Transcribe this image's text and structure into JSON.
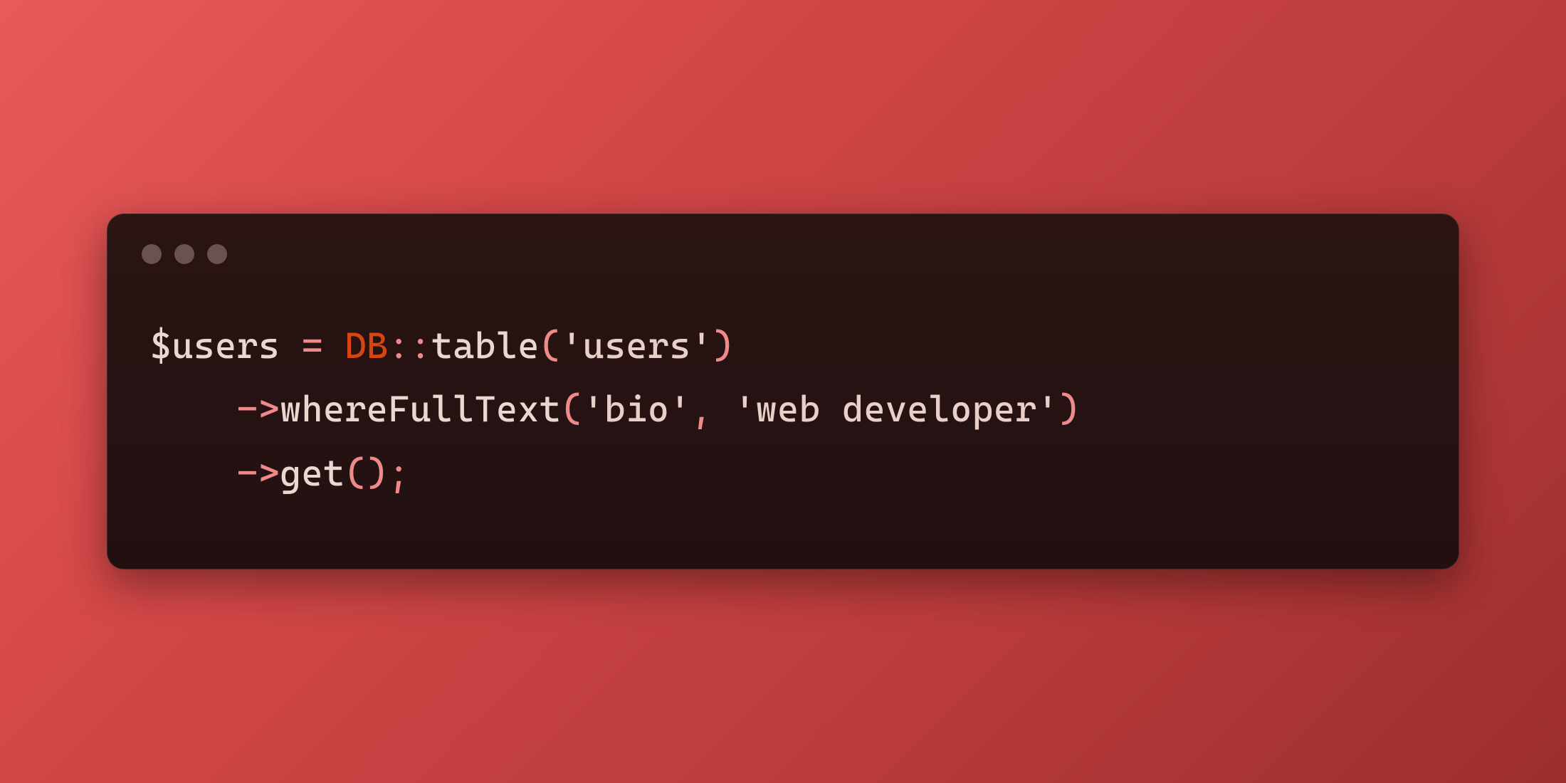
{
  "code": {
    "lines": [
      {
        "indent": "",
        "tokens": [
          {
            "cls": "tok-default",
            "text": "$users "
          },
          {
            "cls": "tok-punct",
            "text": "= "
          },
          {
            "cls": "tok-keyword",
            "text": "DB"
          },
          {
            "cls": "tok-punct",
            "text": "::"
          },
          {
            "cls": "tok-method",
            "text": "table"
          },
          {
            "cls": "tok-punct",
            "text": "("
          },
          {
            "cls": "tok-string",
            "text": "'users'"
          },
          {
            "cls": "tok-punct",
            "text": ")"
          }
        ]
      },
      {
        "indent": "    ",
        "tokens": [
          {
            "cls": "tok-punct",
            "text": "->"
          },
          {
            "cls": "tok-method",
            "text": "whereFullText"
          },
          {
            "cls": "tok-punct",
            "text": "("
          },
          {
            "cls": "tok-string",
            "text": "'bio'"
          },
          {
            "cls": "tok-punct",
            "text": ", "
          },
          {
            "cls": "tok-string",
            "text": "'web developer'"
          },
          {
            "cls": "tok-punct",
            "text": ")"
          }
        ]
      },
      {
        "indent": "    ",
        "tokens": [
          {
            "cls": "tok-punct",
            "text": "->"
          },
          {
            "cls": "tok-method",
            "text": "get"
          },
          {
            "cls": "tok-punct",
            "text": "();"
          }
        ]
      }
    ]
  }
}
